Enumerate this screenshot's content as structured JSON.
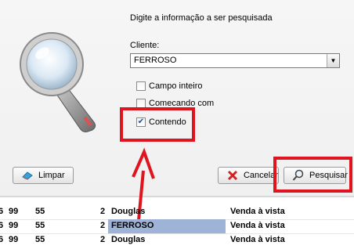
{
  "dialog": {
    "prompt": "Digite a informação a ser pesquisada",
    "client_label": "Cliente:",
    "client_value": "FERROSO",
    "options": [
      {
        "label": "Campo inteiro",
        "checked": false
      },
      {
        "label": "Comecando com",
        "checked": false
      },
      {
        "label": "Contendo",
        "checked": true
      }
    ],
    "buttons": {
      "clear": "Limpar",
      "cancel": "Cancelar",
      "search": "Pesquisar"
    }
  },
  "grid": {
    "rows": [
      {
        "c0": "6",
        "c1": "99",
        "c2": "55",
        "c3": "2",
        "name": "Douglas",
        "payment": "Venda à vista",
        "selected": false
      },
      {
        "c0": "6",
        "c1": "99",
        "c2": "55",
        "c3": "2",
        "name": "FERROSO",
        "payment": "Venda à vista",
        "selected": true
      },
      {
        "c0": "6",
        "c1": "99",
        "c2": "55",
        "c3": "2",
        "name": "Douglas",
        "payment": "Venda à vista",
        "selected": false
      }
    ]
  },
  "colors": {
    "annotation": "#e0141f",
    "selection": "#9fb3d6"
  }
}
